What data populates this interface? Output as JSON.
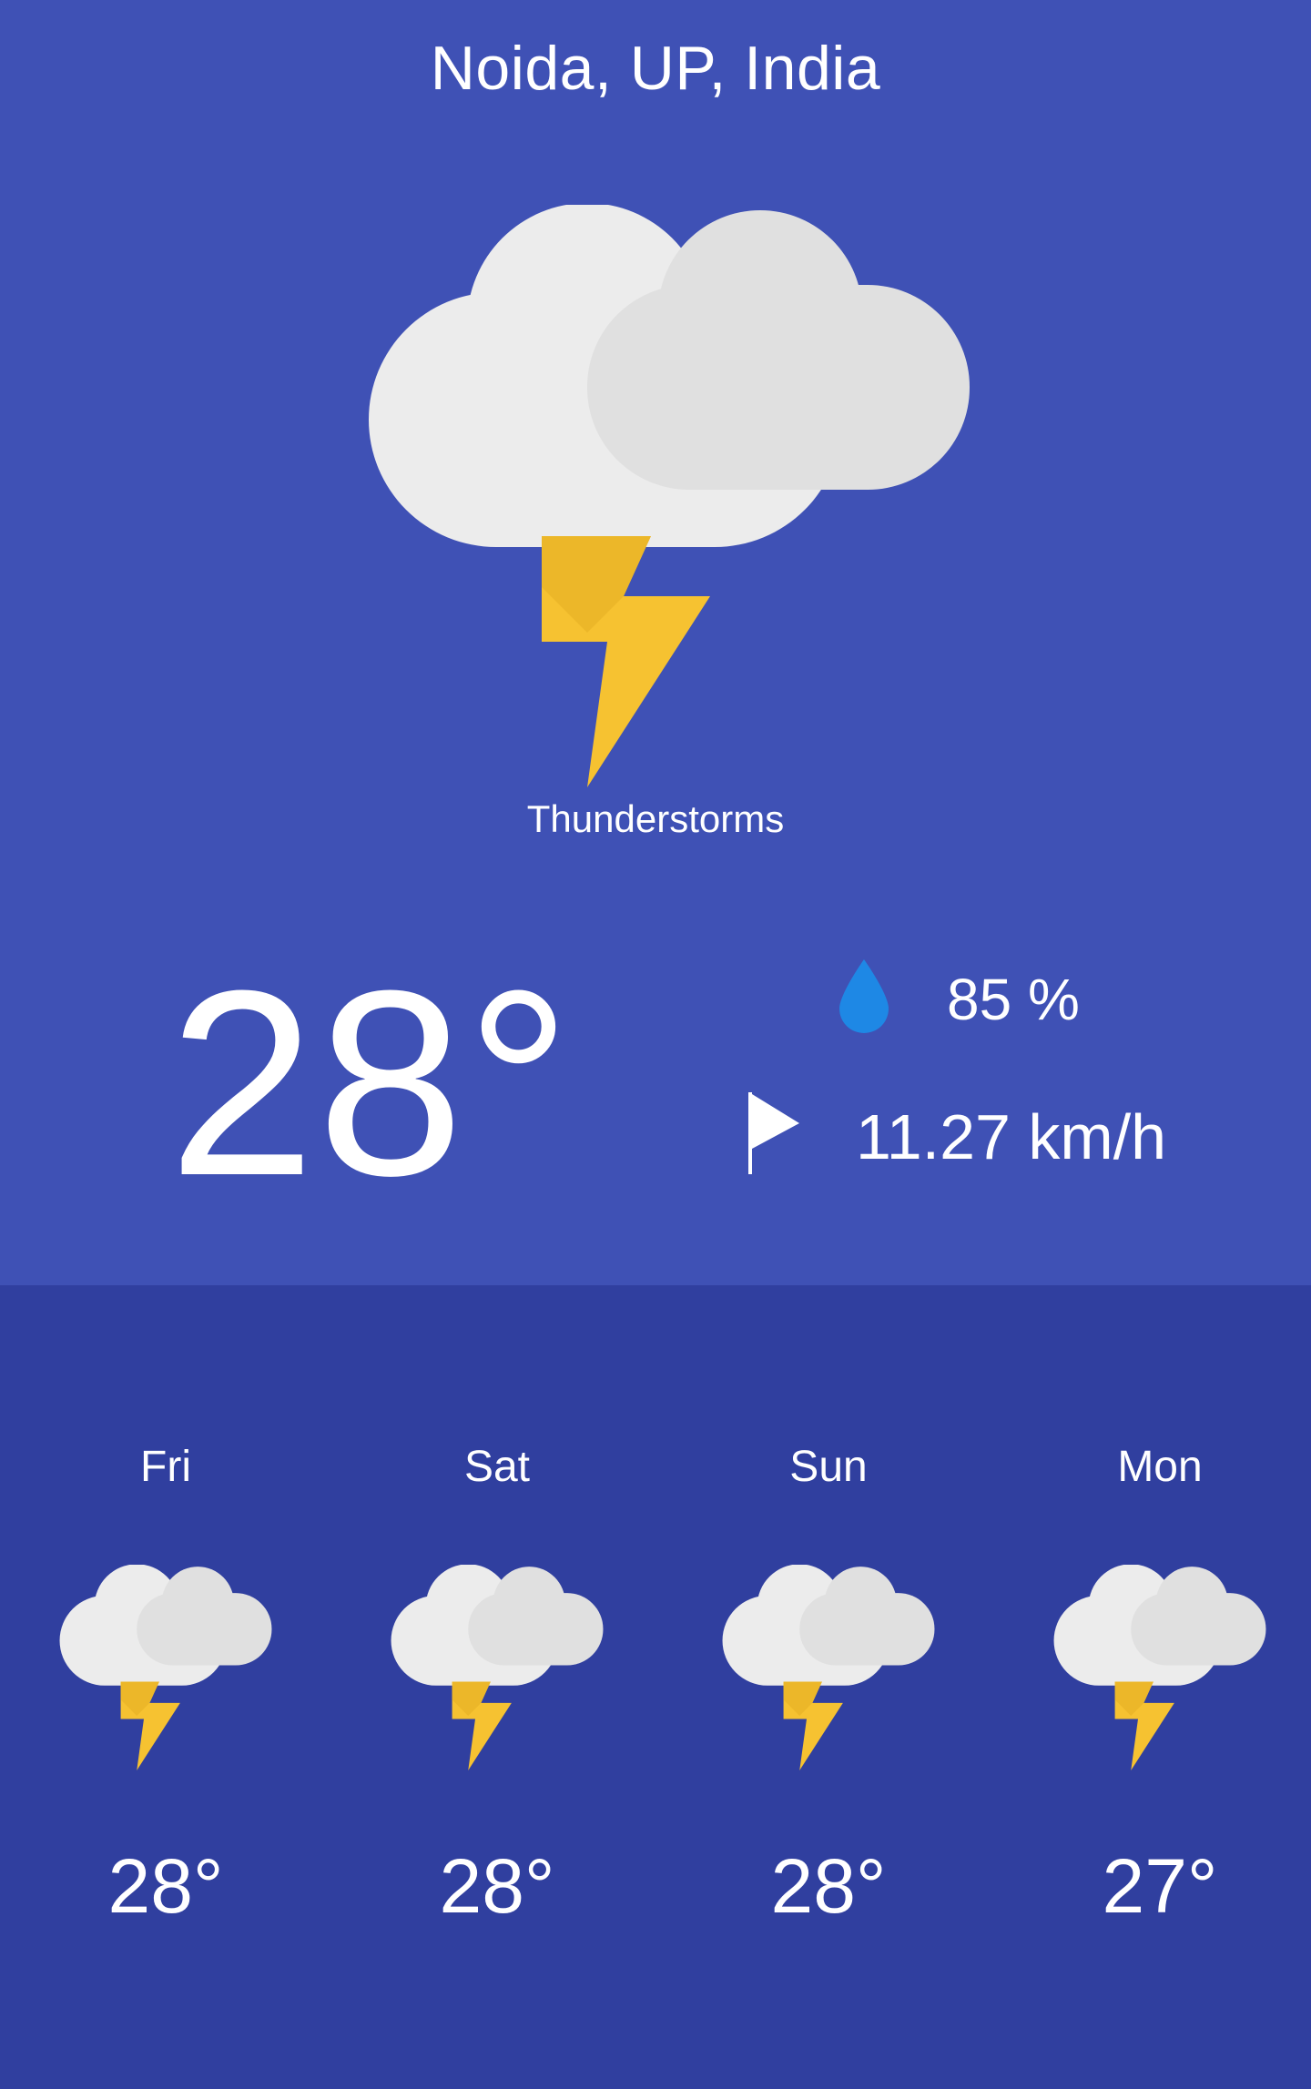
{
  "location": "Noida, UP, India",
  "current": {
    "icon": "thunderstorm-icon",
    "condition": "Thunderstorms",
    "temperature": "28°",
    "humidity": "85 %",
    "humidity_icon": "water-drop-icon",
    "wind": "11.27 km/h",
    "wind_icon": "flag-icon"
  },
  "forecast": [
    {
      "day": "Fri",
      "temp": "28°",
      "icon": "thunderstorm-icon"
    },
    {
      "day": "Sat",
      "temp": "28°",
      "icon": "thunderstorm-icon"
    },
    {
      "day": "Sun",
      "temp": "28°",
      "icon": "thunderstorm-icon"
    },
    {
      "day": "Mon",
      "temp": "27°",
      "icon": "thunderstorm-icon"
    }
  ],
  "colors": {
    "top_background": "#3f51b5",
    "bottom_background": "#303f9f",
    "cloud_light": "#eeeeee",
    "cloud_shade": "#e0e0e0",
    "bolt": "#f9c732",
    "drop": "#1e88e5"
  }
}
